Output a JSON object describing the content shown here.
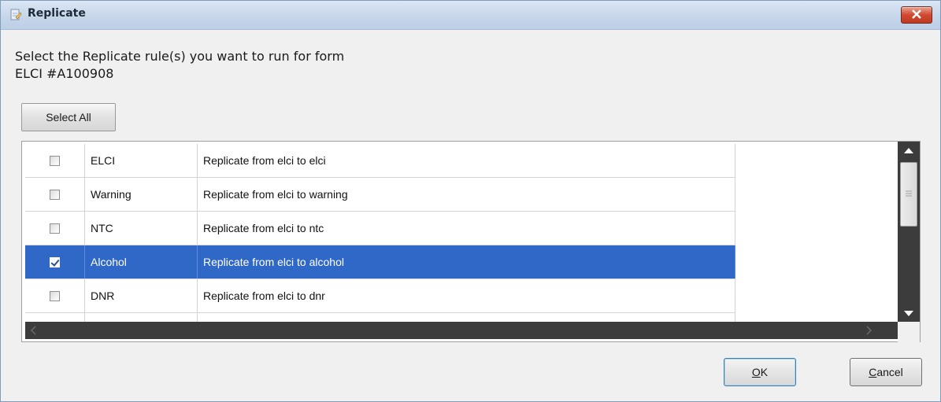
{
  "window": {
    "title": "Replicate"
  },
  "prompt": {
    "line1": "Select the Replicate rule(s) you want to run for form",
    "line2": "ELCI #A100908"
  },
  "toolbar": {
    "select_all_label": "Select All"
  },
  "rules": [
    {
      "name": "ELCI",
      "description": "Replicate from elci to elci",
      "checked": false,
      "selected": false
    },
    {
      "name": "Warning",
      "description": "Replicate from elci to warning",
      "checked": false,
      "selected": false
    },
    {
      "name": "NTC",
      "description": "Replicate from elci to ntc",
      "checked": false,
      "selected": false
    },
    {
      "name": "Alcohol",
      "description": "Replicate from elci to alcohol",
      "checked": true,
      "selected": true
    },
    {
      "name": "DNR",
      "description": "Replicate from elci to dnr",
      "checked": false,
      "selected": false
    }
  ],
  "buttons": {
    "ok_mnemonic": "O",
    "ok_rest": "K",
    "cancel_mnemonic": "C",
    "cancel_rest": "ancel"
  },
  "colors": {
    "selection": "#3068c8",
    "close_button": "#c03a22"
  }
}
